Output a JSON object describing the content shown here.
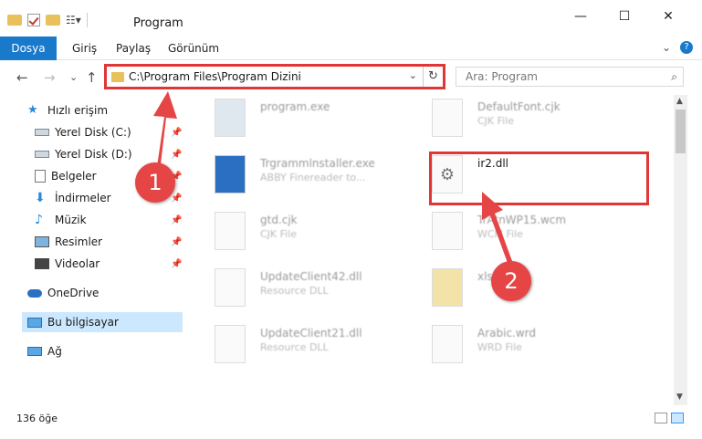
{
  "window": {
    "title": "Program",
    "minimize": "—",
    "maximize": "☐",
    "close": "✕"
  },
  "ribbon": {
    "file_tab": "Dosya",
    "tabs": [
      "Giriş",
      "Paylaş",
      "Görünüm"
    ],
    "expand": "⌄",
    "help": "?"
  },
  "nav": {
    "back": "←",
    "forward": "→",
    "dropdown": "⌄",
    "up": "↑",
    "address": "C:\\Program Files\\Program Dizini",
    "address_dropdown": "⌄",
    "refresh": "↻",
    "search_placeholder": "Ara: Program",
    "search_icon": "⌕"
  },
  "sidebar": {
    "items": [
      {
        "label": "Hızlı erişim",
        "icon": "star-icon"
      },
      {
        "label": "Yerel Disk (C:)",
        "icon": "drive-icon",
        "pinned": true
      },
      {
        "label": "Yerel Disk (D:)",
        "icon": "drive-icon",
        "pinned": true
      },
      {
        "label": "Belgeler",
        "icon": "documents-icon",
        "pinned": true
      },
      {
        "label": "İndirmeler",
        "icon": "download-icon",
        "pinned": true
      },
      {
        "label": "Müzik",
        "icon": "music-icon",
        "pinned": true
      },
      {
        "label": "Resimler",
        "icon": "pictures-icon",
        "pinned": true
      },
      {
        "label": "Videolar",
        "icon": "videos-icon",
        "pinned": true
      },
      {
        "label": "OneDrive",
        "icon": "cloud-icon"
      },
      {
        "label": "Bu bilgisayar",
        "icon": "computer-icon",
        "selected": true
      },
      {
        "label": "Ağ",
        "icon": "network-icon"
      }
    ]
  },
  "files": [
    {
      "name": "program.exe",
      "type": ""
    },
    {
      "name": "DefaultFont.cjk",
      "type": "CJK File"
    },
    {
      "name": "Trgrammlnstaller.exe",
      "type": "ABBY Finereader to..."
    },
    {
      "name": "ir2.dll",
      "type": ""
    },
    {
      "name": "gtd.cjk",
      "type": "CJK File"
    },
    {
      "name": "TrAtnWP15.wcm",
      "type": "WCM File"
    },
    {
      "name": "UpdateClient42.dll",
      "type": "Resource DLL"
    },
    {
      "name": "xls",
      "type": ""
    },
    {
      "name": "UpdateClient21.dll",
      "type": "Resource DLL"
    },
    {
      "name": "Arabic.wrd",
      "type": "WRD File"
    }
  ],
  "status": {
    "item_count": "136 öğe"
  },
  "annotations": {
    "step1": "1",
    "step2": "2"
  },
  "colors": {
    "accent": "#1979ca",
    "highlight": "#e03636",
    "selection": "#cce8ff"
  }
}
